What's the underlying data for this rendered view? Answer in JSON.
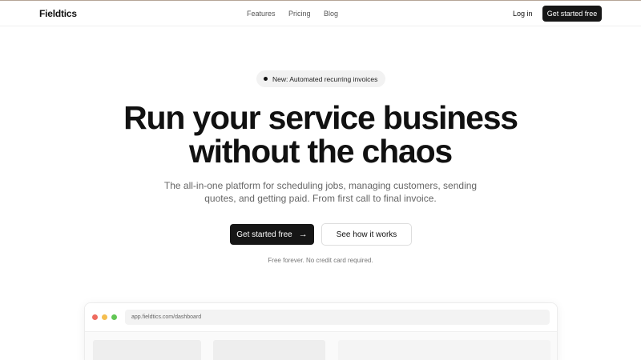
{
  "nav": {
    "brand": "Fieldtics",
    "links": [
      "Features",
      "Pricing",
      "Blog"
    ],
    "login": "Log in",
    "cta": "Get started free"
  },
  "hero": {
    "badge": "New: Automated recurring invoices",
    "headline_line1": "Run your service business",
    "headline_line2": "without the chaos",
    "subtitle": "The all-in-one platform for scheduling jobs, managing customers, sending quotes, and getting paid. From first call to final invoice.",
    "primary_cta": "Get started free",
    "primary_cta_icon": "arrow-right-icon",
    "secondary_cta": "See how it works",
    "note": "Free forever. No credit card required."
  },
  "preview": {
    "url": "app.fieldtics.com/dashboard"
  },
  "colors": {
    "accent_dark": "#161616",
    "traffic_red": "#ee6b5f",
    "traffic_yellow": "#f5be4f",
    "traffic_green": "#62c655"
  }
}
